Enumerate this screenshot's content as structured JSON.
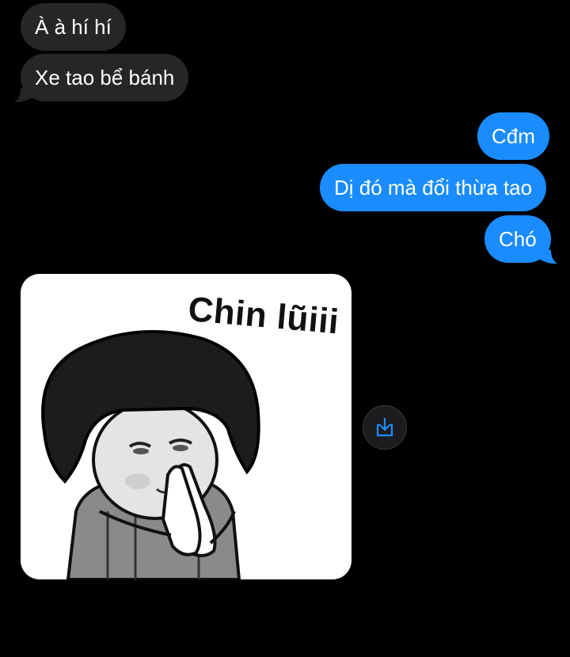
{
  "conversation": {
    "incoming_messages": [
      {
        "text": "À à hí hí"
      },
      {
        "text": "Xe tao bể bánh"
      }
    ],
    "outgoing_messages": [
      {
        "text": "Cđm"
      },
      {
        "text": "Dị đó mà đổi thừa tao"
      },
      {
        "text": "Chó"
      }
    ],
    "sticker": {
      "caption": "Chin lũiii",
      "icon": "sticker-image"
    },
    "save_button": {
      "icon": "save-download-icon"
    }
  },
  "colors": {
    "background": "#000000",
    "incoming_bubble": "#262628",
    "outgoing_bubble": "#1a8cff",
    "save_icon": "#1a8cff"
  }
}
